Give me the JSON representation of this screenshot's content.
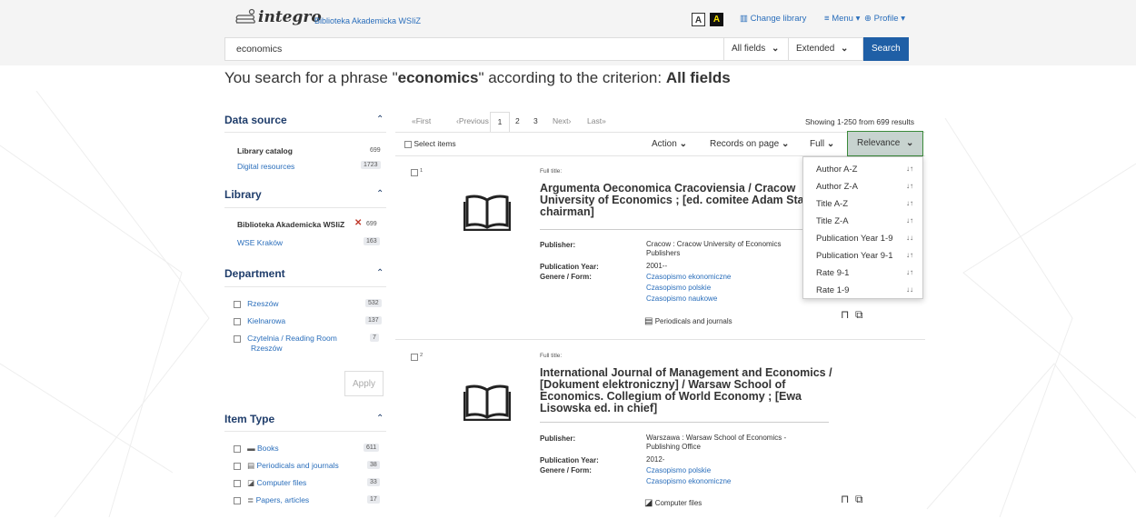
{
  "header": {
    "logo_text": "integro",
    "library_name": "Biblioteka Akademicka WSIiZ",
    "contrast_normal": "A",
    "contrast_high": "A",
    "change_library": "Change library",
    "menu": "Menu",
    "profile": "Profile"
  },
  "search": {
    "query": "economics",
    "field": "All fields",
    "mode": "Extended",
    "button": "Search"
  },
  "headline": {
    "prefix": "You search for a phrase \"",
    "phrase": "economics",
    "middle": "\" according to the criterion: ",
    "criterion": "All fields"
  },
  "sidebar": {
    "data_source": {
      "title": "Data source",
      "items": [
        {
          "label": "Library catalog",
          "count": "699"
        },
        {
          "label": "Digital resources",
          "count": "1723"
        }
      ]
    },
    "library": {
      "title": "Library",
      "selected": {
        "label": "Biblioteka Akademicka WSIiZ",
        "count": "699"
      },
      "other": {
        "label": "WSE Kraków",
        "count": "163"
      }
    },
    "department": {
      "title": "Department",
      "items": [
        {
          "label": "Rzeszów",
          "count": "532"
        },
        {
          "label": "Kielnarowa",
          "count": "137"
        },
        {
          "label": "Czytelnia / Reading Room",
          "label2": "Rzeszów",
          "count": "7"
        }
      ],
      "apply": "Apply"
    },
    "item_type": {
      "title": "Item Type",
      "items": [
        {
          "label": "Books",
          "count": "611"
        },
        {
          "label": "Periodicals and journals",
          "count": "38"
        },
        {
          "label": "Computer files",
          "count": "33"
        },
        {
          "label": "Papers, articles",
          "count": "17"
        }
      ]
    }
  },
  "pager": {
    "first": "«First",
    "prev": "‹Previous",
    "pages": [
      "1",
      "2",
      "3"
    ],
    "next": "Next›",
    "last": "Last»",
    "showing": "Showing 1-250 from 699 results"
  },
  "toolbar": {
    "select_items": "Select items",
    "action": "Action",
    "records_on_page": "Records on page",
    "view": "Full",
    "sort": "Relevance"
  },
  "sort_options": [
    "Author A-Z",
    "Author Z-A",
    "Title A-Z",
    "Title Z-A",
    "Publication Year 1-9",
    "Publication Year 9-1",
    "Rate 9-1",
    "Rate 1-9"
  ],
  "results": [
    {
      "num": "1",
      "full_title_label": "Full title:",
      "title_lines": [
        "Argumenta Oeconomica Cracoviensia / Cracow",
        "University of Economics ; [ed. comitee Adam Stabr",
        "chairman]"
      ],
      "publisher_label": "Publisher:",
      "publisher_lines": [
        "Cracow : Cracow University of Economics",
        "Publishers"
      ],
      "year_label": "Publication Year:",
      "year": "2001--",
      "genre_label": "Genere / Form:",
      "genres": [
        "Czasopismo ekonomiczne",
        "Czasopismo polskie",
        "Czasopismo naukowe"
      ],
      "type": "Periodicals and journals"
    },
    {
      "num": "2",
      "full_title_label": "Full title:",
      "title_lines": [
        "International Journal of Management and Economics /",
        "[Dokument elektroniczny] / Warsaw School of",
        "Economics. Collegium of World Economy ; [Ewa",
        "Lisowska ed. in chief]"
      ],
      "publisher_label": "Publisher:",
      "publisher_lines": [
        "Warszawa : Warsaw School of Economics -",
        "Publishing Office"
      ],
      "year_label": "Publication Year:",
      "year": "2012-",
      "genre_label": "Genere / Form:",
      "genres": [
        "Czasopismo polskie",
        "Czasopismo ekonomiczne"
      ],
      "type": "Computer files"
    }
  ]
}
